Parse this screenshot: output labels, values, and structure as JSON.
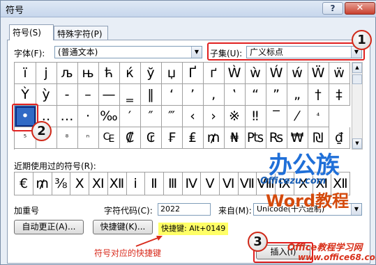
{
  "window": {
    "title": "符号",
    "help_label": "?",
    "close_label": "✕"
  },
  "tabs": [
    {
      "label": "符号(S)"
    },
    {
      "label": "特殊字符(P)"
    }
  ],
  "font": {
    "label": "字体(F):",
    "value": "(普通文本)"
  },
  "subset": {
    "label": "子集(U):",
    "value": "广义标点"
  },
  "symbols": [
    [
      "ï",
      "j",
      "љ",
      "њ",
      "ћ",
      "ќ",
      "ў",
      "џ",
      "Ґ",
      "ґ",
      "Ẁ",
      "ẁ",
      "Ẃ",
      "ẃ",
      "Ẅ",
      "ẅ"
    ],
    [
      "Ỳ",
      "ỳ",
      "‐",
      "–",
      "—",
      "‗",
      "‖",
      "‘",
      "’",
      "‚",
      "‛",
      "“",
      "”",
      "„",
      "†",
      "‡"
    ],
    [
      "•",
      "‥",
      "…",
      "‧",
      "‰",
      "′",
      "″",
      "‴",
      "‹",
      "›",
      "※",
      "‼",
      "‾",
      "⁄",
      "⁴"
    ],
    [
      "⁵",
      "⁶",
      "⁸",
      "ⁿ",
      "₠",
      "₡",
      "₢",
      "₣",
      "₤",
      "₥",
      "₦",
      "₧",
      "₨",
      "₩",
      "₪",
      "₫"
    ]
  ],
  "recent": {
    "label": "近期使用过的符号(R):",
    "symbols": [
      "€",
      "₥",
      "⅜",
      "Ⅹ",
      "Ⅺ",
      "Ⅻ",
      "ⅰ",
      "Ⅱ",
      "Ⅲ",
      "Ⅳ",
      "Ⅴ",
      "Ⅵ",
      "Ⅶ",
      "Ⅷ",
      "Ⅸ",
      "Ⅹ",
      "Ⅺ",
      "Ⅻ"
    ]
  },
  "symbol_name": "加重号",
  "char_code": {
    "label": "字符代码(C):",
    "value": "2022"
  },
  "from": {
    "label": "来自(M):",
    "value": "Unicode(十六进制)"
  },
  "buttons": {
    "autocorrect": "自动更正(A)...",
    "shortcut": "快捷键(K)...",
    "insert": "插入(I)"
  },
  "shortcut_text": "快捷键: Alt+0149",
  "annotation": "符号对应的快捷键",
  "callouts": [
    "1",
    "2",
    "3"
  ],
  "watermarks": {
    "office_brand": "办公族",
    "office_url": "Officezu.com",
    "word_tutorial": "Word教程",
    "study_site": "Office教程学习网",
    "study_url": "www.office68.com"
  },
  "colors": {
    "accent": "#316ac5",
    "annotation_red": "#d82a1c",
    "highlight": "#ffff66"
  }
}
